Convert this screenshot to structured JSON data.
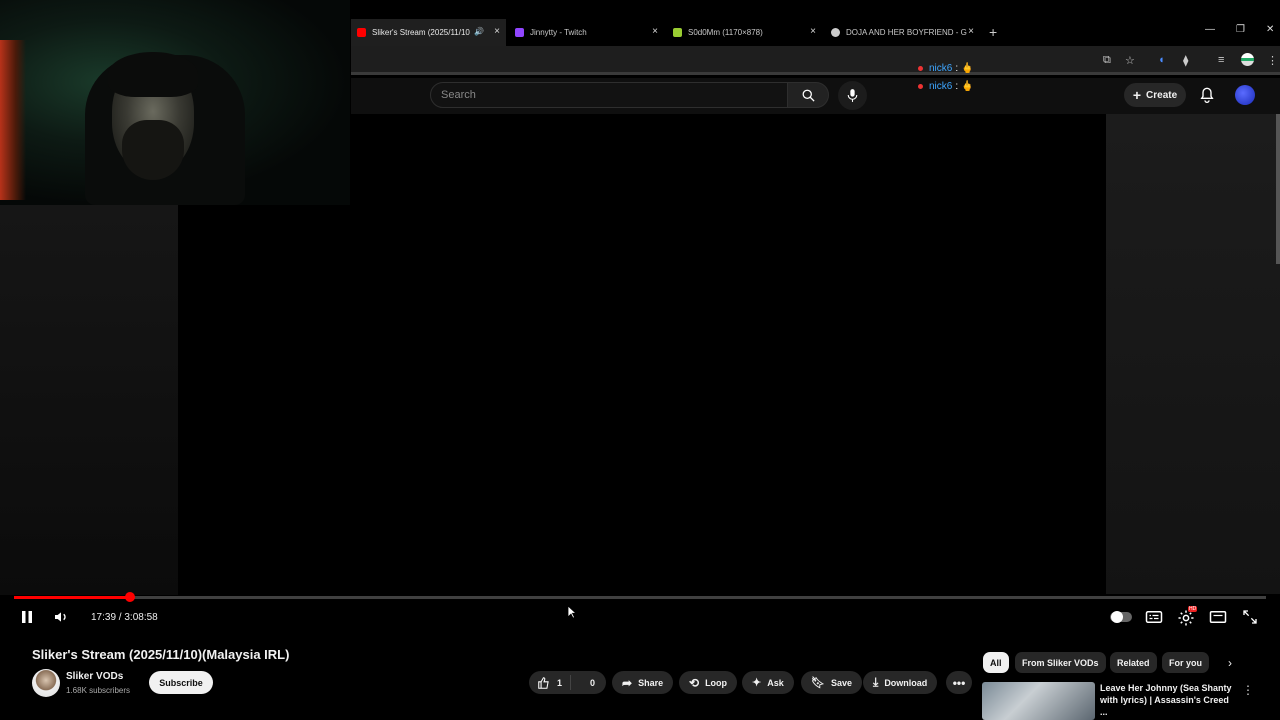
{
  "browser": {
    "tabs": [
      {
        "title": "Sliker's Stream (2025/11/10",
        "favicon_color": "#ff0000",
        "active": true
      },
      {
        "title": "Jinnytty - Twitch",
        "favicon_color": "#9146ff",
        "active": false
      },
      {
        "title": "S0d0Mm (1170×878)",
        "favicon_color": "#9acd32",
        "active": false
      },
      {
        "title": "DOJA AND HER BOYFRIEND - G",
        "favicon_color": "#cccccc",
        "active": false
      }
    ],
    "close_glyph": "×",
    "new_tab_glyph": "+"
  },
  "youtube_header": {
    "search_placeholder": "Search",
    "create_label": "Create"
  },
  "chat_overlay": [
    {
      "user": "nick6",
      "message": "🖕"
    },
    {
      "user": "nick6",
      "message": "🖕"
    }
  ],
  "player": {
    "time_current": "17:39",
    "time_total": "3:08:58",
    "time_display": "17:39 / 3:08:58",
    "progress_fraction": 0.093,
    "progress_color": "#ff0000",
    "playing": true
  },
  "video": {
    "title": "Sliker's Stream (2025/11/10)(Malaysia IRL)",
    "channel": "Sliker VODs",
    "subscribers": "1.68K subscribers",
    "subscribe_label": "Subscribe",
    "likes": "1",
    "dislikes": "0",
    "actions": {
      "share": "Share",
      "loop": "Loop",
      "ask": "Ask",
      "save": "Save",
      "download": "Download"
    }
  },
  "related": {
    "chips": [
      "All",
      "From Sliker VODs",
      "Related",
      "For you"
    ],
    "selected_chip": "All",
    "first_item_title": "Leave Her Johnny (Sea Shanty with lyrics) | Assassin's Creed ..."
  }
}
